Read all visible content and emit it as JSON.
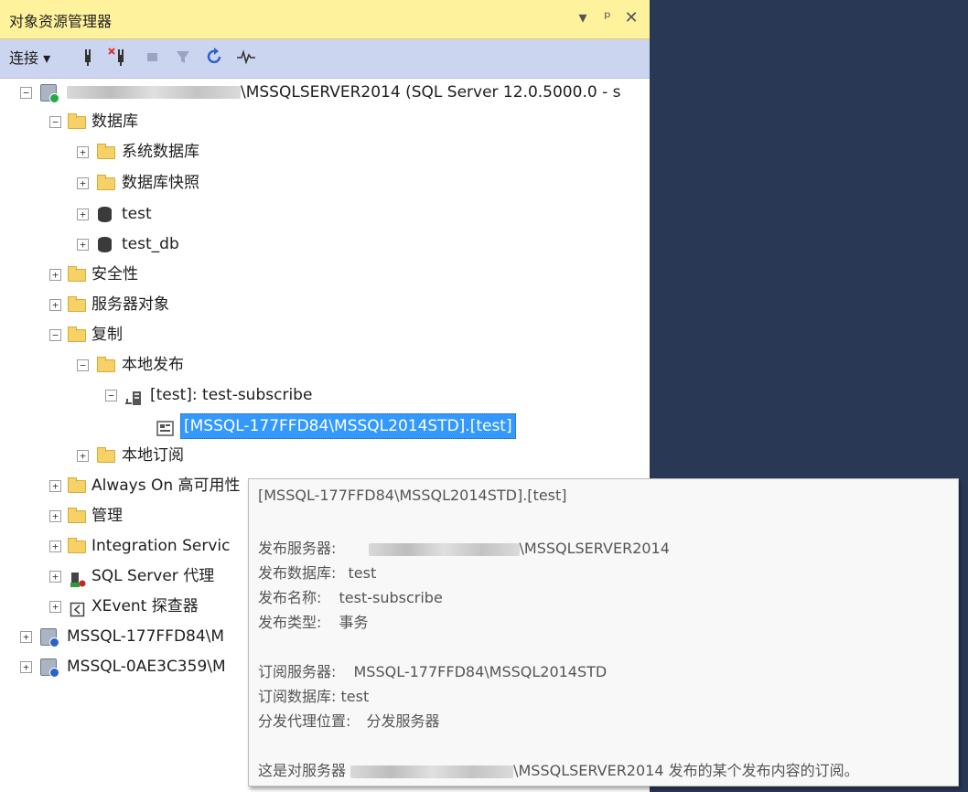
{
  "panel": {
    "title": "对象资源管理器",
    "controls": {
      "dropdown": "▾",
      "pin": "ᵖ",
      "close": "✕"
    },
    "toolbar": {
      "connect_label": "连接 ▾"
    }
  },
  "tree": {
    "server_root_suffix": "\\MSSQLSERVER2014 (SQL Server 12.0.5000.0 - s",
    "databases": "数据库",
    "system_databases": "系统数据库",
    "db_snapshots": "数据库快照",
    "db_test": "test",
    "db_test_db": "test_db",
    "security": "安全性",
    "server_objects": "服务器对象",
    "replication": "复制",
    "local_publications": "本地发布",
    "publication": "[test]: test-subscribe",
    "subscription": "[MSSQL-177FFD84\\MSSQL2014STD].[test]",
    "local_subscriptions": "本地订阅",
    "always_on": "Always On 高可用性",
    "management": "管理",
    "integration_services": "Integration Servic",
    "sql_agent": "SQL Server 代理",
    "xevent": "XEvent 探查器",
    "server2": "MSSQL-177FFD84\\M",
    "server3": "MSSQL-0AE3C359\\M"
  },
  "tooltip": {
    "header": "[MSSQL-177FFD84\\MSSQL2014STD].[test]",
    "publisher_label": "发布服务器:",
    "publisher_suffix": "\\MSSQLSERVER2014",
    "pub_db_label": "发布数据库:",
    "pub_db_value": "test",
    "pub_name_label": "发布名称:",
    "pub_name_value": "test-subscribe",
    "pub_type_label": "发布类型:",
    "pub_type_value": "事务",
    "subscriber_label": "订阅服务器:",
    "subscriber_value": "MSSQL-177FFD84\\MSSQL2014STD",
    "sub_db_label": "订阅数据库:",
    "sub_db_value": "test",
    "dist_label": "分发代理位置:",
    "dist_value": "分发服务器",
    "footer_prefix": "这是对服务器",
    "footer_suffix": "\\MSSQLSERVER2014 发布的某个发布内容的订阅。"
  }
}
